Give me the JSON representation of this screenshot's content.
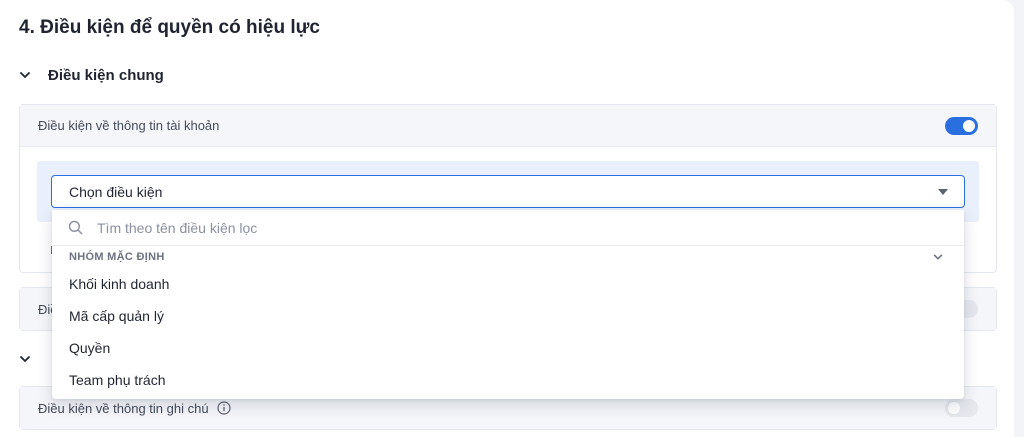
{
  "section": {
    "title": "4. Điều kiện để quyền có hiệu lực"
  },
  "general_group": {
    "title": "Điều kiện chung"
  },
  "account_panel": {
    "label": "Điều kiện về thông tin tài khoản",
    "enabled": true
  },
  "condition_select": {
    "value": "Chọn điều kiện"
  },
  "dropdown": {
    "search_placeholder": "Tìm theo tên điều kiện lọc",
    "group_label": "NHÓM MẶC ĐỊNH",
    "options": [
      "Khối kinh doanh",
      "Mã cấp quản lý",
      "Quyền",
      "Team phụ trách"
    ]
  },
  "second_panel": {
    "label_fragment": "Điề",
    "enabled": false
  },
  "notes_panel": {
    "label": "Điều kiện về thông tin ghi chú",
    "enabled": false
  },
  "colors": {
    "accent": "#2a6fe0",
    "panel_head_bg": "#f5f6fa",
    "condition_bg": "#eaf0fb"
  }
}
